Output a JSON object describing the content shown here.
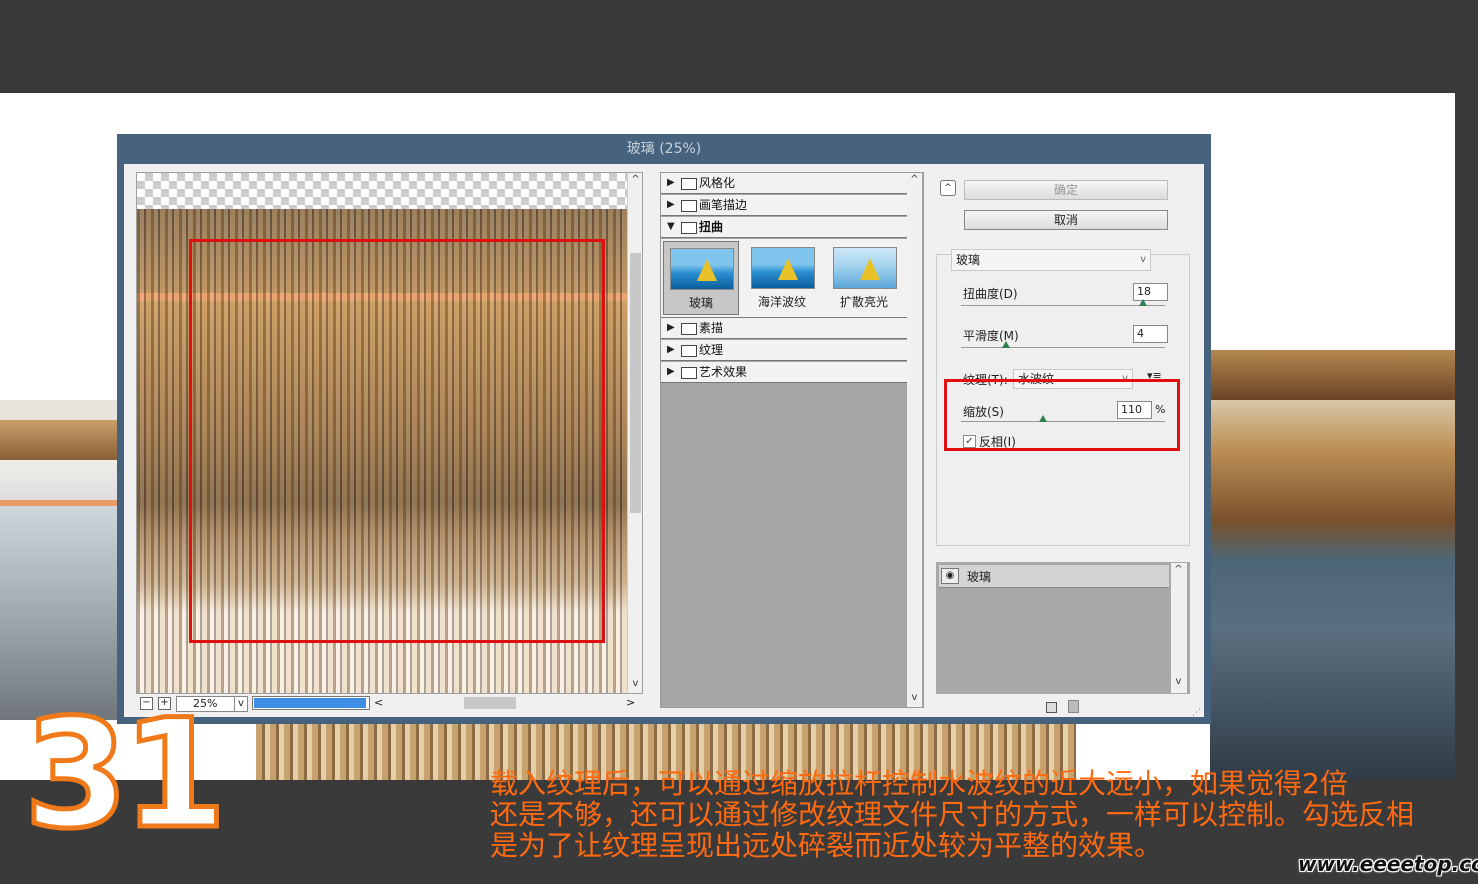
{
  "dialog": {
    "title": "玻璃 (25%)",
    "zoom": "25%",
    "zoom_minus": "−",
    "zoom_plus": "+"
  },
  "filter_tree": {
    "categories": [
      {
        "label": "风格化",
        "expanded": false
      },
      {
        "label": "画笔描边",
        "expanded": false
      },
      {
        "label": "扭曲",
        "expanded": true
      },
      {
        "label": "素描",
        "expanded": false
      },
      {
        "label": "纹理",
        "expanded": false
      },
      {
        "label": "艺术效果",
        "expanded": false
      }
    ],
    "thumbnails": [
      {
        "label": "玻璃",
        "selected": true
      },
      {
        "label": "海洋波纹",
        "selected": false
      },
      {
        "label": "扩散亮光",
        "selected": false
      }
    ]
  },
  "settings": {
    "ok_label": "确定",
    "cancel_label": "取消",
    "filter_name": "玻璃",
    "distortion_label": "扭曲度(D)",
    "distortion_value": "18",
    "smoothness_label": "平滑度(M)",
    "smoothness_value": "4",
    "texture_label": "纹理(T):",
    "texture_value": "水波纹",
    "scale_label": "缩放(S)",
    "scale_value": "110",
    "scale_unit": "%",
    "invert_label": "反相(I)",
    "invert_checked": true
  },
  "layers": {
    "items": [
      {
        "label": "玻璃"
      }
    ]
  },
  "overlay": {
    "step_number": "31",
    "caption_lines": [
      "载入纹理后，可以通过缩放拉杆控制水波纹的近大远小，如果觉得2倍",
      "还是不够，还可以通过修改纹理文件尺寸的方式，一样可以控制。勾选反相",
      "是为了让纹理呈现出远处碎裂而近处较为平整的效果。"
    ],
    "watermark": "www.eeeetop.com"
  },
  "colors": {
    "dialog_frame": "#46627d",
    "highlight_red": "#e01010",
    "caption_orange": "#ff6a10",
    "slider_knob": "#2f7f4e",
    "progress_blue": "#3f8ee6"
  }
}
